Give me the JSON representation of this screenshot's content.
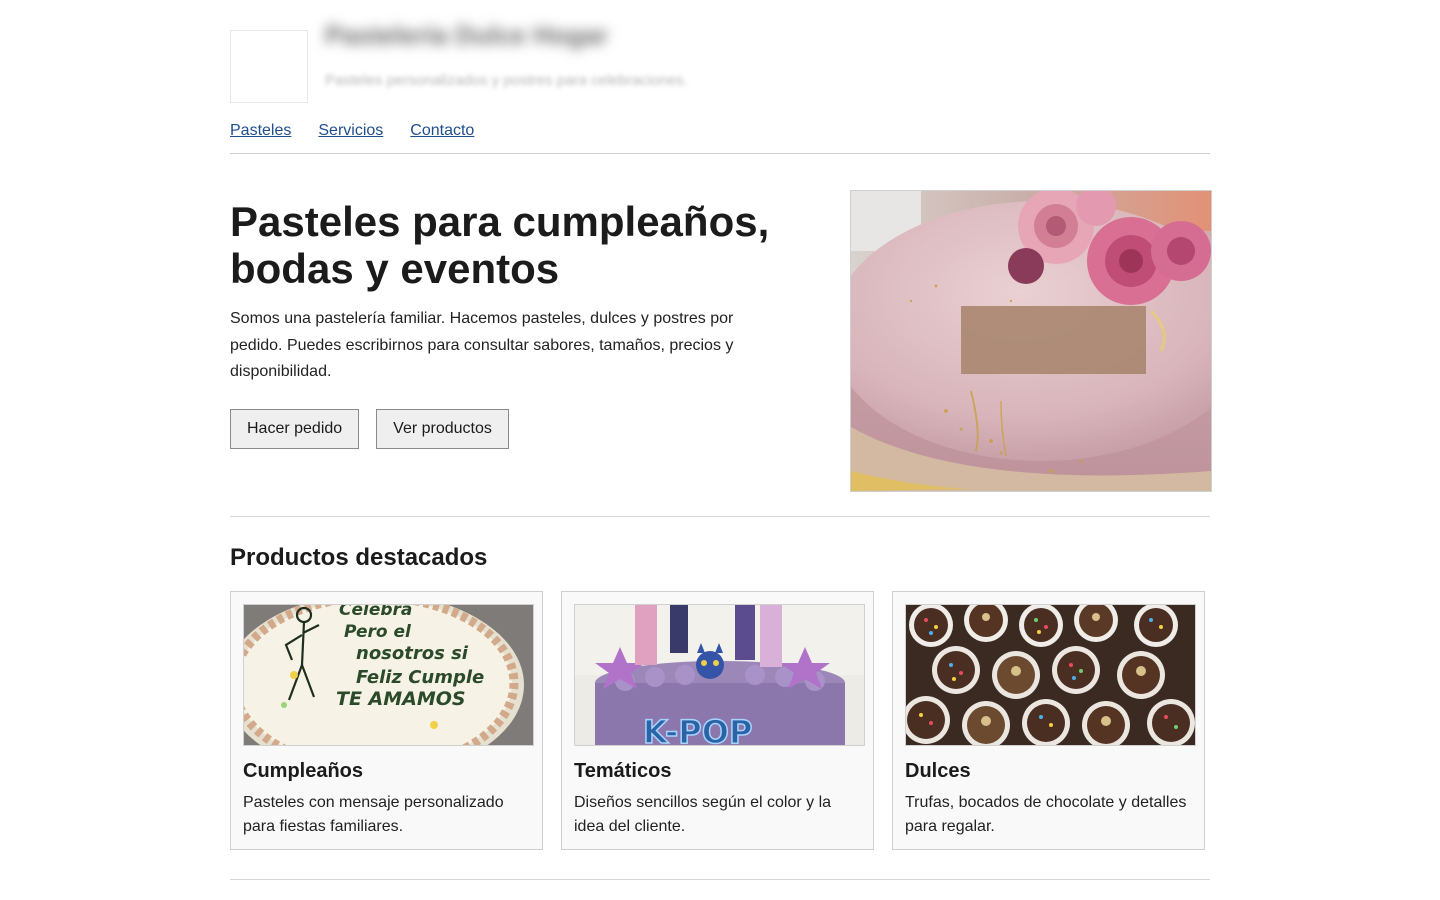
{
  "header": {
    "brand_name": "Pastelería Dulce Hogar",
    "tagline": "Pasteles personalizados y postres para celebraciones."
  },
  "nav": {
    "items": [
      {
        "label": "Pasteles"
      },
      {
        "label": "Servicios"
      },
      {
        "label": "Contacto"
      }
    ]
  },
  "hero": {
    "title": "Pasteles para cumpleaños, bodas y eventos",
    "text": "Somos una pastelería familiar. Hacemos pasteles, dulces y postres por pedido. Puedes escribirnos para consultar sabores, tamaños, precios y disponibilidad.",
    "primary_button": "Hacer pedido",
    "secondary_button": "Ver productos"
  },
  "products": {
    "title": "Productos destacados",
    "cards": [
      {
        "title": "Cumpleaños",
        "text": "Pasteles con mensaje personalizado para fiestas familiares.",
        "cake_text": [
          "Celebra",
          "Pero el",
          "nosotros si",
          "Feliz Cumple",
          "TE AMAMOS"
        ]
      },
      {
        "title": "Temáticos",
        "text": "Diseños sencillos según el color y la idea del cliente.",
        "cake_text": "K-POP"
      },
      {
        "title": "Dulces",
        "text": "Trufas, bocados de chocolate y detalles para regalar."
      }
    ]
  }
}
